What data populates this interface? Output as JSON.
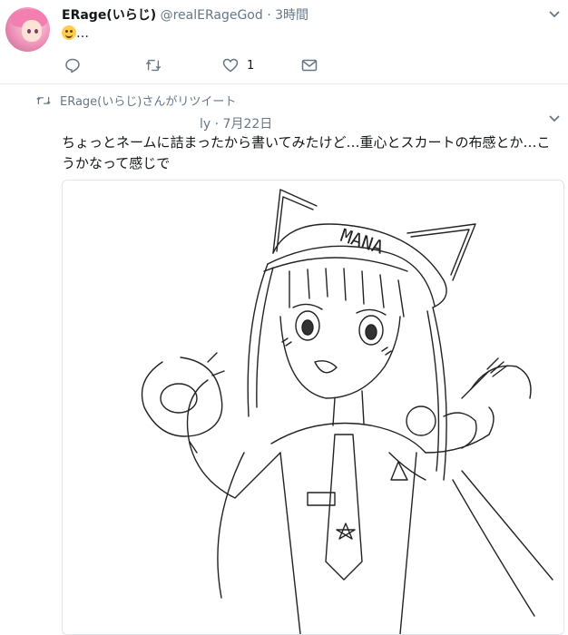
{
  "tweet1": {
    "display_name": "ERage(いらじ)",
    "handle": "@realERageGod",
    "separator": "·",
    "time": "3時間",
    "text_suffix": "…",
    "emoji_icon": "smiling-face-icon",
    "like_count": "1"
  },
  "retweet_context": {
    "label": "ERage(いらじ)さんがリツイート"
  },
  "tweet2": {
    "author_fragment": "ly",
    "separator": "·",
    "date": "7月22日",
    "text": "ちょっとネームに詰まったから書いてみたけど…重心とスカートの布感とか…こうかなって感じで"
  },
  "drawing": {
    "cap_text": "MANA"
  },
  "icons": {
    "reply": "reply-icon",
    "retweet": "retweet-icon",
    "like": "heart-icon",
    "dm": "envelope-icon",
    "menu": "chevron-down-icon"
  },
  "colors": {
    "text": "#14171a",
    "secondary": "#657786",
    "divider": "#e6ecf0"
  }
}
